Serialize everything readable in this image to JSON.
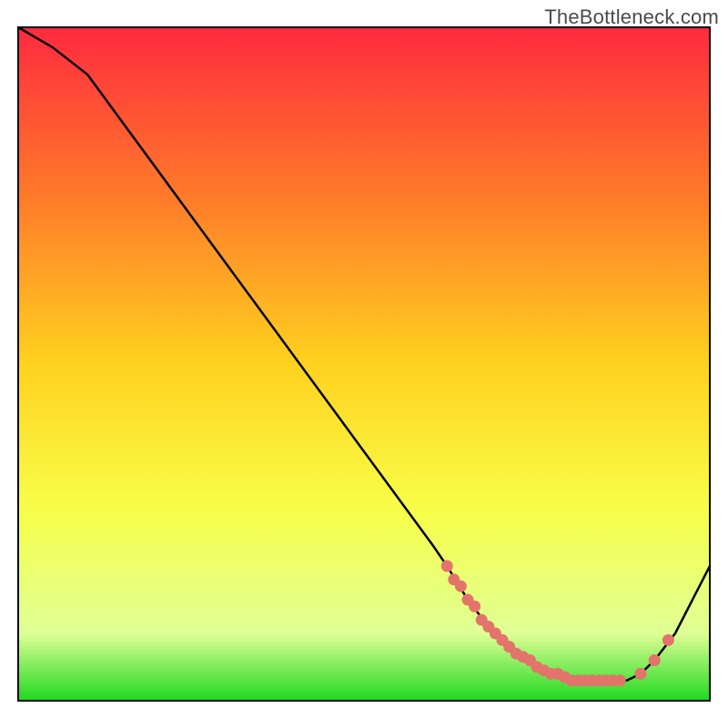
{
  "watermark": "TheBottleneck.com",
  "chart_data": {
    "type": "line",
    "title": "",
    "xlabel": "",
    "ylabel": "",
    "xlim": [
      0,
      100
    ],
    "ylim": [
      0,
      100
    ],
    "grid": false,
    "legend": false,
    "series": [
      {
        "name": "curve",
        "x": [
          0,
          5,
          10,
          15,
          20,
          25,
          30,
          35,
          40,
          45,
          50,
          55,
          60,
          62,
          65,
          68,
          70,
          72,
          75,
          78,
          80,
          83,
          86,
          88,
          90,
          92,
          95,
          100
        ],
        "y": [
          100,
          97,
          93,
          86,
          79,
          72,
          65,
          58,
          51,
          44,
          37,
          30,
          23,
          20,
          15,
          11,
          9,
          7,
          5,
          4,
          3,
          3,
          3,
          3,
          4,
          6,
          10,
          20
        ]
      }
    ],
    "markers": {
      "name": "highlight-dots",
      "color": "#e2746c",
      "x": [
        62,
        63,
        64,
        65,
        66,
        67,
        68,
        69,
        70,
        71,
        72,
        73,
        74,
        75,
        76,
        77,
        78,
        79,
        80,
        81,
        82,
        83,
        84,
        85,
        86,
        87,
        90,
        92,
        94
      ],
      "y": [
        20,
        18,
        17,
        15,
        14,
        12,
        11,
        10,
        9,
        8,
        7,
        6.5,
        6,
        5,
        4.5,
        4,
        4,
        3.5,
        3,
        3,
        3,
        3,
        3,
        3,
        3,
        3,
        4,
        6,
        9
      ]
    },
    "background_gradient": {
      "top": "#ff2a3f",
      "upper_mid": "#ff7a2a",
      "mid": "#ffd21f",
      "lower_mid": "#f7ff4a",
      "lower": "#dfff96",
      "bottom": "#1fd81f"
    }
  }
}
